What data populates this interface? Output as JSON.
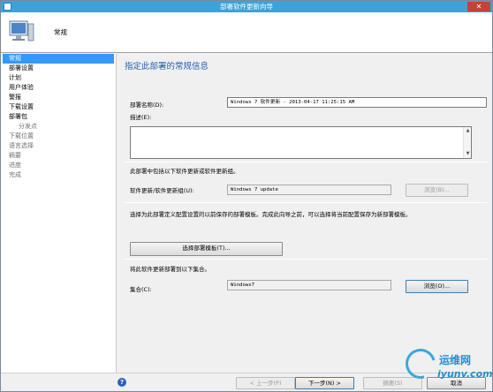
{
  "window": {
    "title": "部署软件更新向导",
    "close_label": "✕"
  },
  "header": {
    "heading": "常规"
  },
  "sidebar": {
    "items": [
      {
        "label": "常规",
        "state": "active"
      },
      {
        "label": "部署设置",
        "state": "normal"
      },
      {
        "label": "计划",
        "state": "normal"
      },
      {
        "label": "用户体验",
        "state": "normal"
      },
      {
        "label": "警报",
        "state": "normal"
      },
      {
        "label": "下载设置",
        "state": "normal"
      },
      {
        "label": "部署包",
        "state": "normal"
      },
      {
        "label": "分发点",
        "state": "sub"
      },
      {
        "label": "下载位置",
        "state": "disabled"
      },
      {
        "label": "语言选择",
        "state": "disabled"
      },
      {
        "label": "摘要",
        "state": "disabled"
      },
      {
        "label": "进度",
        "state": "disabled"
      },
      {
        "label": "完成",
        "state": "disabled"
      }
    ]
  },
  "main": {
    "page_title": "指定此部署的常规信息",
    "deployment_name_label": "部署名称(D):",
    "deployment_name_value": "Windows 7 软件更新 - 2013-04-17 11:25:15 AM",
    "description_label": "描述(E):",
    "description_value": "",
    "includes_text": "此部署中包括以下软件更新或软件更新组。",
    "update_group_label": "软件更新/软件更新组(U):",
    "update_group_value": "Windows 7 update",
    "browse_disabled_label": "浏览(B)...",
    "template_text": "选择为此部署定义配置设置的以前保存的部署模板。完成此向导之前，可以选择将当前配置保存为新部署模板。",
    "select_template_label": "选择部署模板(T)...",
    "collection_intro": "将此软件更新部署到以下集合。",
    "collection_label": "集合(C):",
    "collection_value": "Windows7",
    "browse_collection_label": "浏览(O)..."
  },
  "footer": {
    "help_glyph": "?",
    "prev_label": "< 上一步(P)",
    "next_label": "下一步(N) >",
    "summary_label": "摘要(S)",
    "cancel_label": "取消"
  },
  "watermark": {
    "line1": "运维网",
    "line2": "iyunv.com"
  },
  "colors": {
    "accent": "#3399ff",
    "titlebar": "#3fa2d7",
    "page_title": "#1f5fb0"
  }
}
